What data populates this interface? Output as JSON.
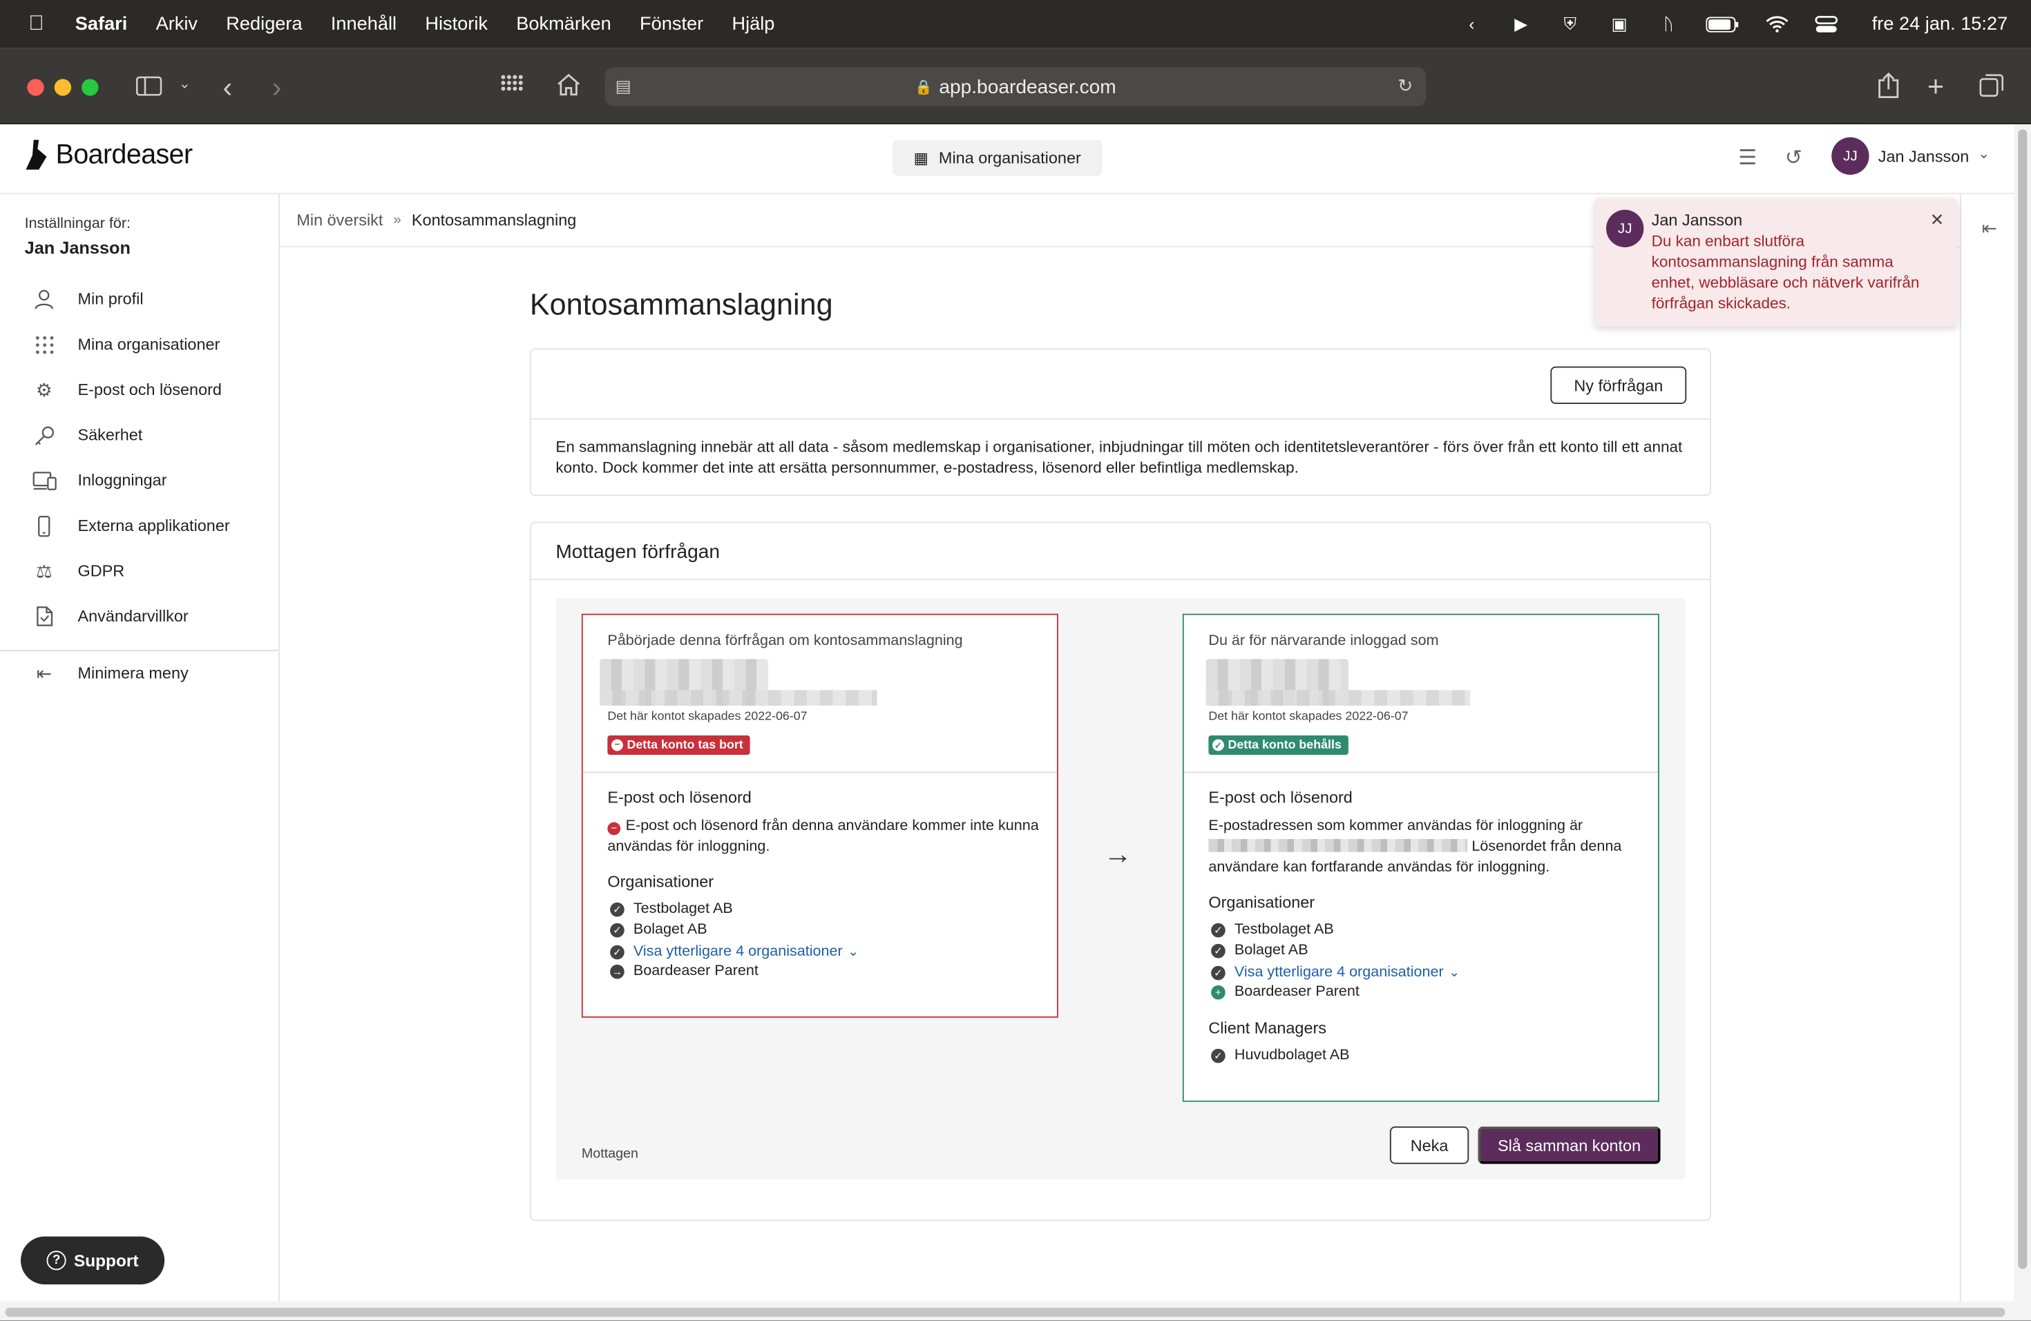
{
  "os_menubar": {
    "app": "Safari",
    "items": [
      "Arkiv",
      "Redigera",
      "Innehåll",
      "Historik",
      "Bokmärken",
      "Fönster",
      "Hjälp"
    ],
    "clock": "fre 24 jan. 15:27"
  },
  "browser": {
    "url": "app.boardeaser.com"
  },
  "header": {
    "logo": "Boardeaser",
    "org_button": "Mina organisationer",
    "user_initials": "JJ",
    "user_name": "Jan Jansson"
  },
  "sidebar": {
    "settings_for": "Inställningar för:",
    "user": "Jan Jansson",
    "items": [
      {
        "label": "Min profil",
        "icon": "user-icon"
      },
      {
        "label": "Mina organisationer",
        "icon": "grid-icon"
      },
      {
        "label": "E-post och lösenord",
        "icon": "gears-icon"
      },
      {
        "label": "Säkerhet",
        "icon": "key-icon"
      },
      {
        "label": "Inloggningar",
        "icon": "devices-icon"
      },
      {
        "label": "Externa applikationer",
        "icon": "phone-icon"
      },
      {
        "label": "GDPR",
        "icon": "scales-icon"
      },
      {
        "label": "Användarvillkor",
        "icon": "document-icon"
      }
    ],
    "minimize": "Minimera meny",
    "support": "Support"
  },
  "breadcrumb": {
    "root": "Min översikt",
    "current": "Kontosammanslagning"
  },
  "page": {
    "title": "Kontosammanslagning",
    "new_request": "Ny förfrågan",
    "info": "En sammanslagning innebär att all data - såsom medlemskap i organisationer, inbjudningar till möten och identitetsleverantörer - förs över från ett konto till ett annat konto. Dock kommer det inte att ersätta personnummer, e-postadress, lösenord eller befintliga medlemskap."
  },
  "request": {
    "title": "Mottagen förfrågan",
    "left": {
      "label": "Påbörjade denna förfrågan om kontosammanslagning",
      "created": "Det här kontot skapades 2022-06-07",
      "badge": "Detta konto tas bort",
      "email_heading": "E-post och lösenord",
      "email_text": "E-post och lösenord från denna användare kommer inte kunna användas för inloggning.",
      "orgs_heading": "Organisationer",
      "orgs": [
        "Testbolaget AB",
        "Bolaget AB"
      ],
      "more_link": "Visa ytterligare 4 organisationer",
      "transfer_org": "Boardeaser Parent"
    },
    "right": {
      "label": "Du är för närvarande inloggad som",
      "created": "Det här kontot skapades 2022-06-07",
      "badge": "Detta konto behålls",
      "email_heading": "E-post och lösenord",
      "email_text_1": "E-postadressen som kommer användas för inloggning är",
      "email_text_2": "Lösenordet från denna användare kan fortfarande användas för inloggning.",
      "orgs_heading": "Organisationer",
      "orgs": [
        "Testbolaget AB",
        "Bolaget AB"
      ],
      "more_link": "Visa ytterligare 4 organisationer",
      "added_org": "Boardeaser Parent",
      "cm_heading": "Client Managers",
      "cm_item": "Huvudbolaget AB"
    },
    "status": "Mottagen",
    "decline": "Neka",
    "merge": "Slå samman konton"
  },
  "toast": {
    "initials": "JJ",
    "name": "Jan Jansson",
    "message": "Du kan enbart slutföra kontosammanslagning från samma enhet, webbläsare och nätverk varifrån förfrågan skickades."
  },
  "colors": {
    "brand": "#5c2d5c",
    "danger": "#c8303a",
    "success": "#2e8b6e",
    "link": "#1f5ea8"
  }
}
